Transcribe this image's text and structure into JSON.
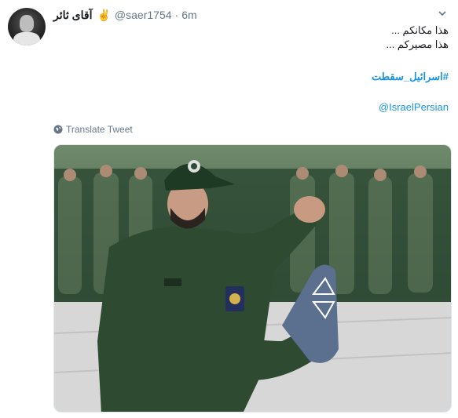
{
  "tweet": {
    "display_name": "آقای ثائر",
    "badge_emoji": "✌",
    "handle": "@saer1754",
    "separator": "·",
    "time": "6m",
    "text_lines": [
      "هذا مكانكم ...",
      "هذا مصيركم ..."
    ],
    "hashtag": "#اسرائیل_سقطت",
    "mention": "@IsraelPersian",
    "translate_label": "Translate Tweet",
    "media_description": "photo"
  },
  "icons": {
    "caret": "chevron-down-icon",
    "translate": "globe-icon"
  },
  "colors": {
    "link": "#1b95e0",
    "secondary_text": "#657786",
    "primary_text": "#14171a",
    "uniform_green": "#2f4a34"
  }
}
